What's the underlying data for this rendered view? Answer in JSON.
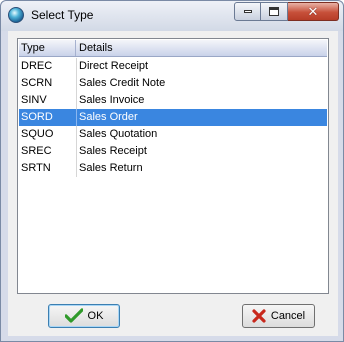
{
  "window": {
    "title": "Select Type",
    "icon": "app-globe-icon",
    "controls": {
      "minimize": "minimize-icon",
      "maximize": "maximize-icon",
      "close": "close-icon"
    }
  },
  "list": {
    "columns": [
      "Type",
      "Details"
    ],
    "rows": [
      {
        "type": "DREC",
        "details": "Direct Receipt"
      },
      {
        "type": "SCRN",
        "details": "Sales Credit Note"
      },
      {
        "type": "SINV",
        "details": "Sales Invoice"
      },
      {
        "type": "SORD",
        "details": "Sales Order"
      },
      {
        "type": "SQUO",
        "details": "Sales Quotation"
      },
      {
        "type": "SREC",
        "details": "Sales Receipt"
      },
      {
        "type": "SRTN",
        "details": "Sales Return"
      }
    ],
    "selected_type": "SORD",
    "selection_color": "#3a86e0"
  },
  "buttons": {
    "ok_label": "OK",
    "ok_icon": "checkmark-icon",
    "cancel_label": "Cancel",
    "cancel_icon": "red-x-icon"
  }
}
